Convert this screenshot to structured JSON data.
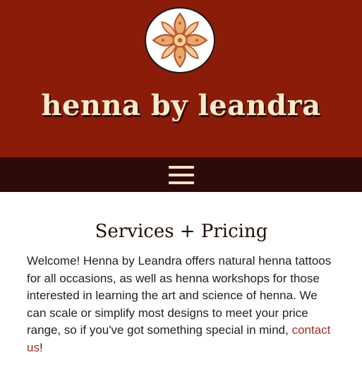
{
  "header": {
    "logo_icon": "henna-flower-icon",
    "site_title": "henna by leandra",
    "bg_color": "#8b1c09"
  },
  "nav": {
    "menu_icon": "hamburger-menu-icon",
    "bg_color": "#2f0a0b"
  },
  "main": {
    "title": "Services + Pricing",
    "intro_text": "Welcome! Henna by Leandra offers natural henna tattoos for all occasions, as well as henna workshops for those interested in learning the art and science of henna. We can scale or simplify most designs to meet your price range, so if you've got something special in mind, ",
    "intro_link": "contact us",
    "intro_end": "!",
    "link_color": "#9b3323"
  }
}
